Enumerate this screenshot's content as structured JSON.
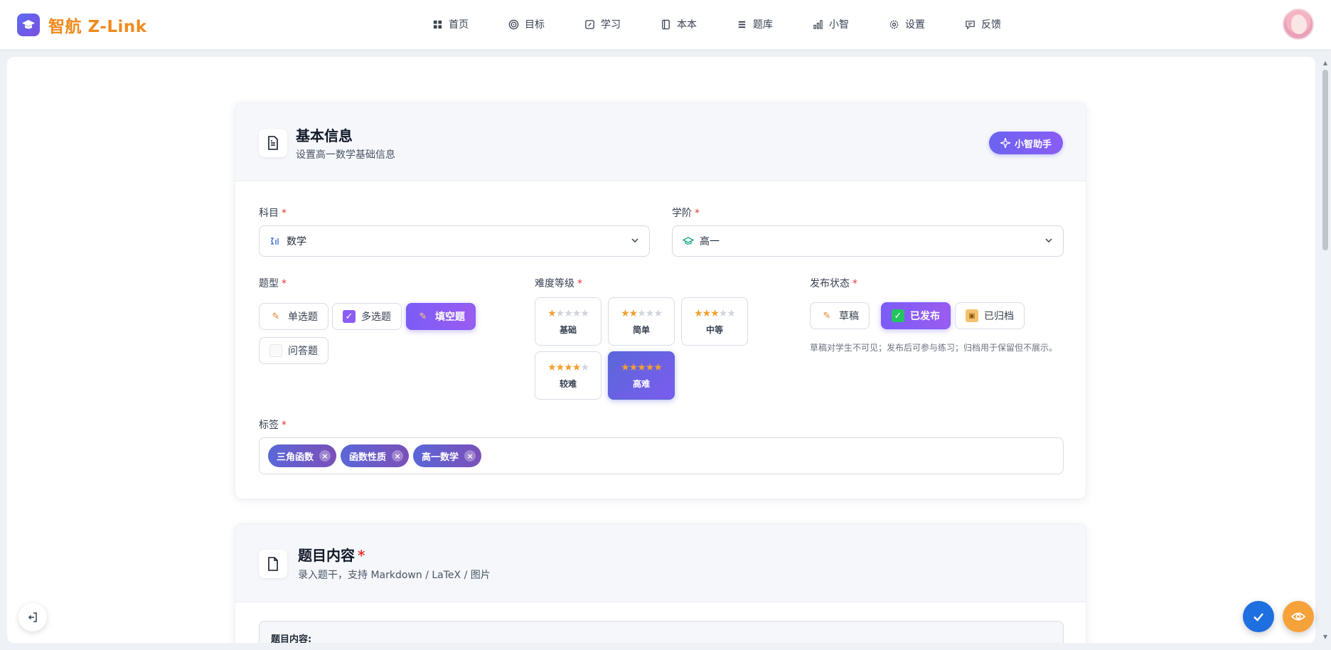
{
  "brand": {
    "name": "智航 Z-Link"
  },
  "nav": [
    {
      "label": "首页",
      "icon": "grid-icon"
    },
    {
      "label": "目标",
      "icon": "target-icon"
    },
    {
      "label": "学习",
      "icon": "edit-square-icon"
    },
    {
      "label": "本本",
      "icon": "notebook-icon"
    },
    {
      "label": "题库",
      "icon": "list-icon"
    },
    {
      "label": "小智",
      "icon": "bar-chart-icon"
    },
    {
      "label": "设置",
      "icon": "gear-icon"
    },
    {
      "label": "反馈",
      "icon": "message-icon"
    }
  ],
  "basic": {
    "title": "基本信息",
    "subtitle": "设置高一数学基础信息",
    "assistant_label": "小智助手",
    "subject_label": "科目",
    "subject_value": "数学",
    "grade_label": "学阶",
    "grade_value": "高一",
    "type_label": "题型",
    "types": [
      {
        "label": "单选题",
        "active": false
      },
      {
        "label": "多选题",
        "active": false
      },
      {
        "label": "填空题",
        "active": true
      },
      {
        "label": "问答题",
        "active": false
      }
    ],
    "difficulty_label": "难度等级",
    "difficulties": [
      {
        "label": "基础",
        "stars": 1,
        "active": false
      },
      {
        "label": "简单",
        "stars": 2,
        "active": false
      },
      {
        "label": "中等",
        "stars": 3,
        "active": false
      },
      {
        "label": "较难",
        "stars": 4,
        "active": false
      },
      {
        "label": "高难",
        "stars": 5,
        "active": true
      }
    ],
    "status_label": "发布状态",
    "statuses": [
      {
        "label": "草稿",
        "active": false
      },
      {
        "label": "已发布",
        "active": true
      },
      {
        "label": "已归档",
        "active": false
      }
    ],
    "status_hint": "草稿对学生不可见；发布后可参与练习；归档用于保留但不展示。",
    "tags_label": "标签",
    "tags": [
      "三角函数",
      "函数性质",
      "高一数学"
    ],
    "required_mark": "*"
  },
  "content": {
    "title": "题目内容",
    "subtitle": "录入题干，支持 Markdown / LaTeX / 图片",
    "box_label": "题目内容:"
  },
  "colors": {
    "accent": "#7b5cf6",
    "brand": "#f08a1c",
    "confirm": "#1e6fe0",
    "preview": "#f5a23a"
  }
}
